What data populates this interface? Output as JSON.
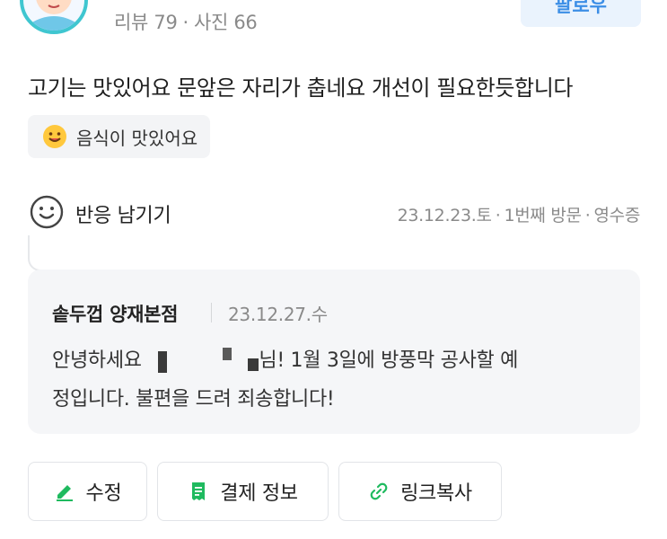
{
  "profile": {
    "review_count_text": "리뷰 79",
    "photo_count_text": "사진 66",
    "separator": "·",
    "follow_label": "팔로우"
  },
  "review": {
    "text": "고기는 맛있어요 문앞은 자리가 춥네요 개선이 필요한듯합니다",
    "keyword": "음식이 맛있어요"
  },
  "reaction": {
    "label": "반응 남기기",
    "visit_date": "23.12.23.토",
    "visit_count": "1번째 방문",
    "receipt": "영수증"
  },
  "owner_reply": {
    "owner_name": "솥두껍 양재본점",
    "date": "23.12.27.수",
    "line1_prefix": "안녕하세요",
    "line1_suffix": "님! 1월 3일에 방풍막 공사할 예",
    "line2": "정입니다. 불편을 드려 죄송합니다!"
  },
  "actions": {
    "edit_label": "수정",
    "payment_label": "결제 정보",
    "copy_link_label": "링크복사"
  },
  "colors": {
    "accent_green": "#1fba5f",
    "follow_blue": "#3c8ee6",
    "muted_text": "#8a8a8a"
  }
}
